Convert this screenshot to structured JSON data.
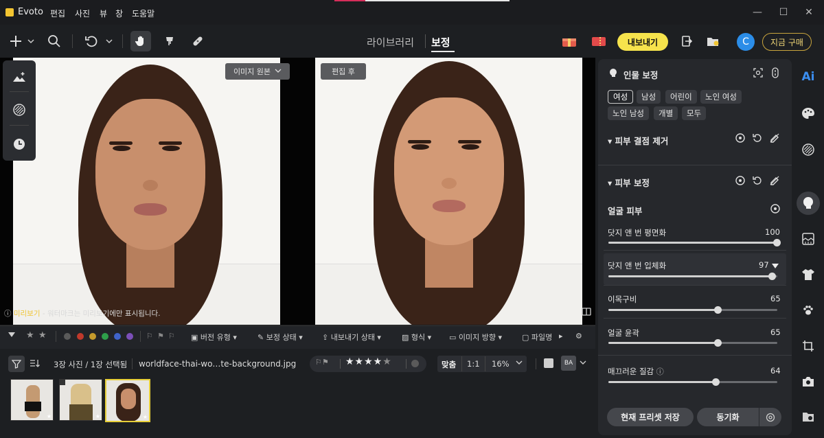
{
  "titlebar": {
    "app_name": "Evoto",
    "menus": [
      "편집",
      "사진",
      "뷰",
      "창",
      "도움말"
    ],
    "minimize": "—",
    "maximize": "☐",
    "close": "✕"
  },
  "toolbar": {
    "tab_library": "라이브러리",
    "tab_retouch": "보정",
    "export_label": "내보내기",
    "avatar_letter": "C",
    "buy_label": "지금 구매"
  },
  "canvas": {
    "before_label": "이미지 원본",
    "after_label": "편집 후",
    "preview_tag": "미리보기",
    "preview_note": " - 워터마크는 미리보기에만 표시됩니다."
  },
  "filterbar": {
    "color_dots": [
      "#5a5a5a",
      "#c0392b",
      "#c49a2c",
      "#2e9e4a",
      "#3f63c9",
      "#7b4fb8"
    ],
    "version_type": "버전 유형",
    "retouch_status": "보정 상태",
    "export_status": "내보내기 상태",
    "format": "형식",
    "orientation": "이미지 방향",
    "file": "파일명"
  },
  "infobar": {
    "photo_count": "3장 사진 / 1장 선택됨",
    "file_name": "worldface-thai-wo…te-background.jpg",
    "fit": "맞춤",
    "ratio": "1:1",
    "zoom": "16%",
    "ba_label": "BA"
  },
  "thumbnails": {
    "rating_star": "★"
  },
  "panel": {
    "title": "인물 보정",
    "chips": [
      "여성",
      "남성",
      "어린이",
      "노인 여성",
      "노인 남성",
      "개별",
      "모두"
    ],
    "section1": "피부 결점 제거",
    "section2": "피부 보정",
    "subsection": "얼굴 피부",
    "sliders": [
      {
        "label": "닷지 앤 번 평면화",
        "value": "100"
      },
      {
        "label": "닷지 앤 번 입체화",
        "value": "97"
      },
      {
        "label": "이목구비",
        "value": "65"
      },
      {
        "label": "얼굴 윤곽",
        "value": "65"
      },
      {
        "label": "매끄러운 질감",
        "value": "64"
      }
    ],
    "save_preset": "현재 프리셋 저장",
    "sync": "동기화"
  },
  "sidebar_right": {
    "ai_label": "Ai"
  }
}
